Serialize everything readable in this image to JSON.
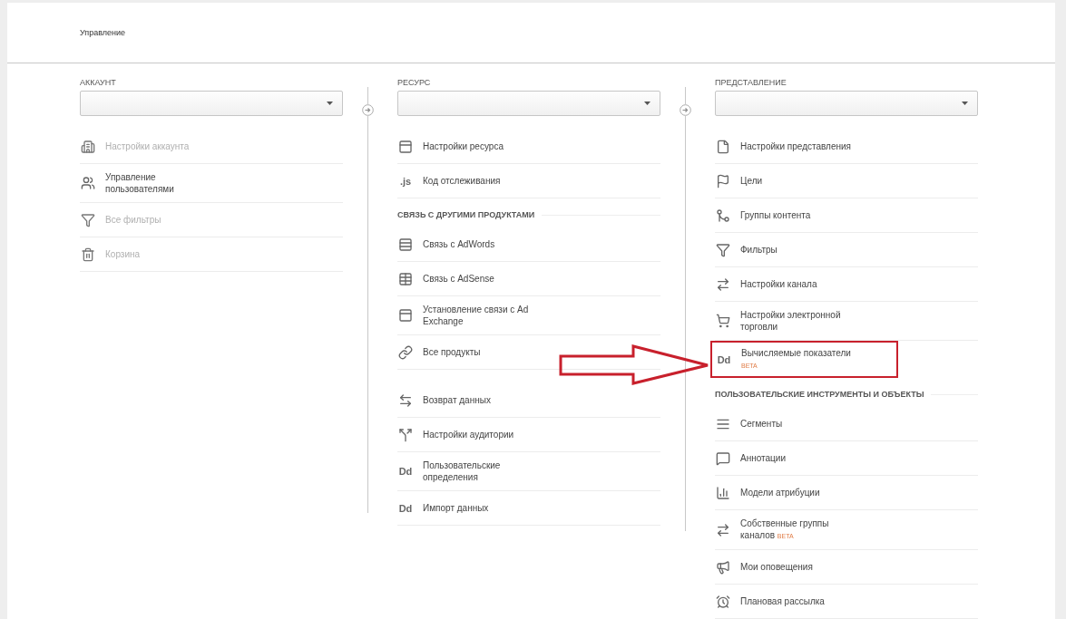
{
  "header": {
    "title": "Управление"
  },
  "columns": [
    {
      "label": "АККАУНТ",
      "items": [
        {
          "kind": "building",
          "label": "Настройки аккаунта",
          "disabled": true
        },
        {
          "kind": "users",
          "label": "Управление\nпользователями",
          "disabled": false
        },
        {
          "kind": "filter",
          "label": "Все фильтры",
          "disabled": true
        },
        {
          "kind": "trash",
          "label": "Корзина",
          "disabled": true
        }
      ]
    },
    {
      "label": "РЕСУРС",
      "items": [
        {
          "kind": "panel",
          "label": "Настройки ресурса",
          "disabled": false
        },
        {
          "kind": "letters",
          "icon_text": ".js",
          "label": "Код отслеживания",
          "disabled": false
        },
        {
          "kind": "section",
          "label": "СВЯЗЬ С ДРУГИМИ ПРОДУКТАМИ"
        },
        {
          "kind": "rows",
          "label": "Связь с AdWords",
          "disabled": false
        },
        {
          "kind": "table",
          "label": "Связь с AdSense",
          "disabled": false
        },
        {
          "kind": "panel",
          "label": "Установление связи с Ad\nExchange",
          "disabled": false
        },
        {
          "kind": "link",
          "label": "Все продукты",
          "disabled": false
        },
        {
          "kind": "spacer"
        },
        {
          "kind": "swap",
          "label": "Возврат данных",
          "disabled": false
        },
        {
          "kind": "split",
          "label": "Настройки аудитории",
          "disabled": false
        },
        {
          "kind": "letters",
          "icon_text": "Dd",
          "label": "Пользовательские\nопределения",
          "disabled": false
        },
        {
          "kind": "letters",
          "icon_text": "Dd",
          "label": "Импорт данных",
          "disabled": false
        }
      ]
    },
    {
      "label": "ПРЕДСТАВЛЕНИЕ",
      "items": [
        {
          "kind": "file",
          "label": "Настройки представления",
          "disabled": false
        },
        {
          "kind": "flag",
          "label": "Цели",
          "disabled": false
        },
        {
          "kind": "merge",
          "label": "Группы контента",
          "disabled": false
        },
        {
          "kind": "filter",
          "label": "Фильтры",
          "disabled": false
        },
        {
          "kind": "channels",
          "label": "Настройки канала",
          "disabled": false
        },
        {
          "kind": "cart",
          "label": "Настройки электронной\nторговли",
          "disabled": false
        },
        {
          "kind": "letters",
          "icon_text": "Dd",
          "label": "Вычисляемые показатели",
          "badge": "BETA",
          "highlighted": true,
          "disabled": false
        },
        {
          "kind": "section",
          "label": "ПОЛЬЗОВАТЕЛЬСКИЕ ИНСТРУМЕНТЫ И ОБЪЕКТЫ"
        },
        {
          "kind": "segments",
          "label": "Сегменты",
          "disabled": false
        },
        {
          "kind": "message",
          "label": "Аннотации",
          "disabled": false
        },
        {
          "kind": "bars",
          "label": "Модели атрибуции",
          "disabled": false
        },
        {
          "kind": "channels",
          "label": "Собственные группы\nканалов",
          "badge": "BETA",
          "disabled": false
        },
        {
          "kind": "megaphone",
          "label": "Мои оповещения",
          "disabled": false
        },
        {
          "kind": "alarm",
          "label": "Плановая рассылка",
          "disabled": false
        }
      ]
    }
  ]
}
